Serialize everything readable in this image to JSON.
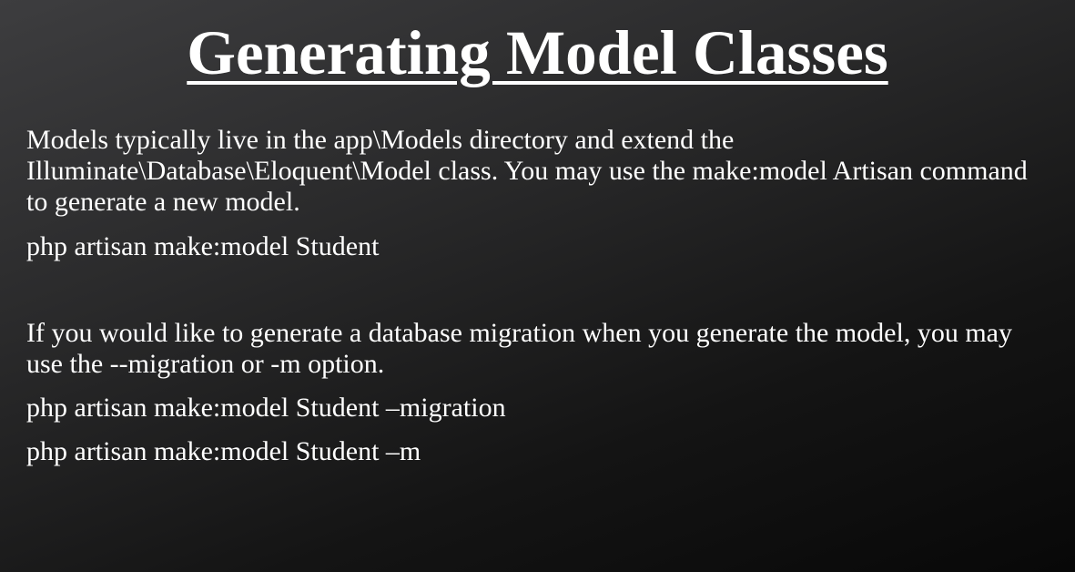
{
  "slide": {
    "title": "Generating Model Classes",
    "paragraph1": "Models typically live in the app\\Models directory and extend the Illuminate\\Database\\Eloquent\\Model class. You may use the make:model Artisan command to generate a new model.",
    "command1": "php artisan make:model Student",
    "paragraph2": "If you would like to generate a database migration when you generate the model, you may use the --migration or -m option.",
    "command2": "php artisan make:model Student –migration",
    "command3": "php artisan make:model Student –m"
  }
}
